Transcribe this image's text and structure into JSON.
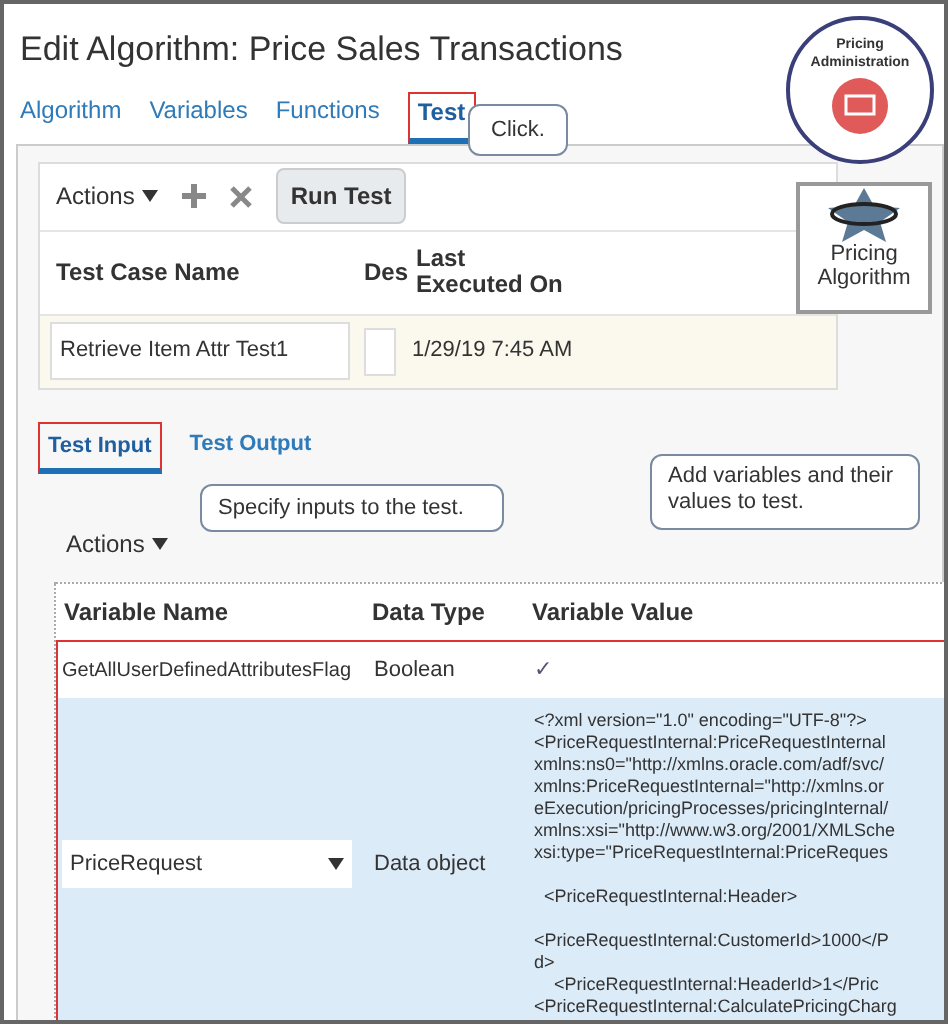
{
  "title": "Edit Algorithm: Price Sales Transactions",
  "tabs": [
    {
      "label": "Algorithm",
      "selected": false
    },
    {
      "label": "Variables",
      "selected": false
    },
    {
      "label": "Functions",
      "selected": false
    },
    {
      "label": "Test",
      "selected": true
    }
  ],
  "badges": {
    "administration": {
      "title": "Pricing Administration"
    },
    "algorithm": {
      "label": "Pricing Algorithm"
    }
  },
  "toolbar": {
    "actions": "Actions",
    "run_test": "Run Test"
  },
  "test_cases": {
    "columns": [
      "Test Case Name",
      "Des",
      "Last Executed On"
    ],
    "rows": [
      {
        "name": "Retrieve Item Attr Test1",
        "last_executed": "1/29/19 7:45 AM"
      }
    ]
  },
  "sub_tabs": [
    {
      "label": "Test Input",
      "selected": true
    },
    {
      "label": "Test Output",
      "selected": false
    }
  ],
  "variables": {
    "actions": "Actions",
    "columns": [
      "Variable Name",
      "Data Type",
      "Variable Value"
    ],
    "rows": [
      {
        "kind": "check",
        "name": "GetAllUserDefinedAttributesFlag",
        "data_type": "Boolean",
        "value": [
          "✓"
        ],
        "selected": false
      },
      {
        "kind": "xml",
        "name": "PriceRequest",
        "data_type": "Data object",
        "selected": true,
        "value": [
          [
            "<?xml version=\"1.0\" encoding=\"UTF-8\"?>",
            "<PriceRequestInternal:PriceRequestInternal",
            "xmlns:ns0=\"http://xmlns.oracle.com/adf/svc/",
            "xmlns:PriceRequestInternal=\"http://xmlns.or",
            "eExecution/pricingProcesses/pricingInternal/",
            "xmlns:xsi=\"http://www.w3.org/2001/XMLSche",
            "xsi:type=\"PriceRequestInternal:PriceReques"
          ],
          [
            "  <PriceRequestInternal:Header>"
          ],
          [
            "<PriceRequestInternal:CustomerId>1000</P",
            "d>",
            "    <PriceRequestInternal:HeaderId>1</Pric",
            "<PriceRequestInternal:CalculatePricingCharg"
          ]
        ]
      }
    ]
  },
  "callouts": [
    {
      "text": "Click."
    },
    {
      "text": "Specify inputs to the test."
    },
    {
      "text": "Add variables  and their values to test."
    }
  ]
}
